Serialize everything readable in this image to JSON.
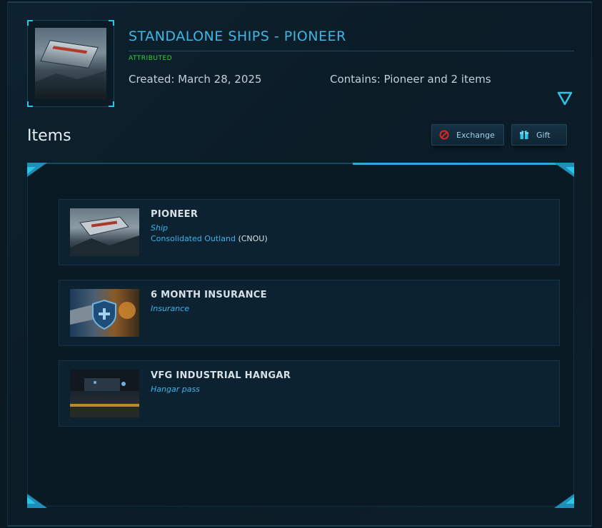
{
  "header": {
    "title": "STANDALONE SHIPS - PIONEER",
    "status": "ATTRIBUTED",
    "created": "Created: March 28, 2025",
    "contains": "Contains: Pioneer and 2 items"
  },
  "items_section": {
    "heading": "Items",
    "buttons": {
      "exchange": "Exchange",
      "gift": "Gift"
    }
  },
  "items": [
    {
      "name": "PIONEER",
      "type": "Ship",
      "manufacturer": "Consolidated Outland",
      "manufacturer_code_open": "(",
      "manufacturer_code": "CNOU",
      "manufacturer_code_close": ")"
    },
    {
      "name": "6 MONTH INSURANCE",
      "type": "Insurance"
    },
    {
      "name": "VFG INDUSTRIAL HANGAR",
      "type": "Hangar pass"
    }
  ],
  "icons": {
    "expand": "chevron-down-triangle-icon",
    "exchange": "no-entry-icon",
    "gift": "gift-box-icon",
    "insurance": "shield-plus-icon"
  },
  "colors": {
    "accent": "#3fb7e6",
    "status_green": "#3ad13a",
    "link_blue": "#3cb3ea",
    "exchange_icon_red": "#e02424"
  }
}
